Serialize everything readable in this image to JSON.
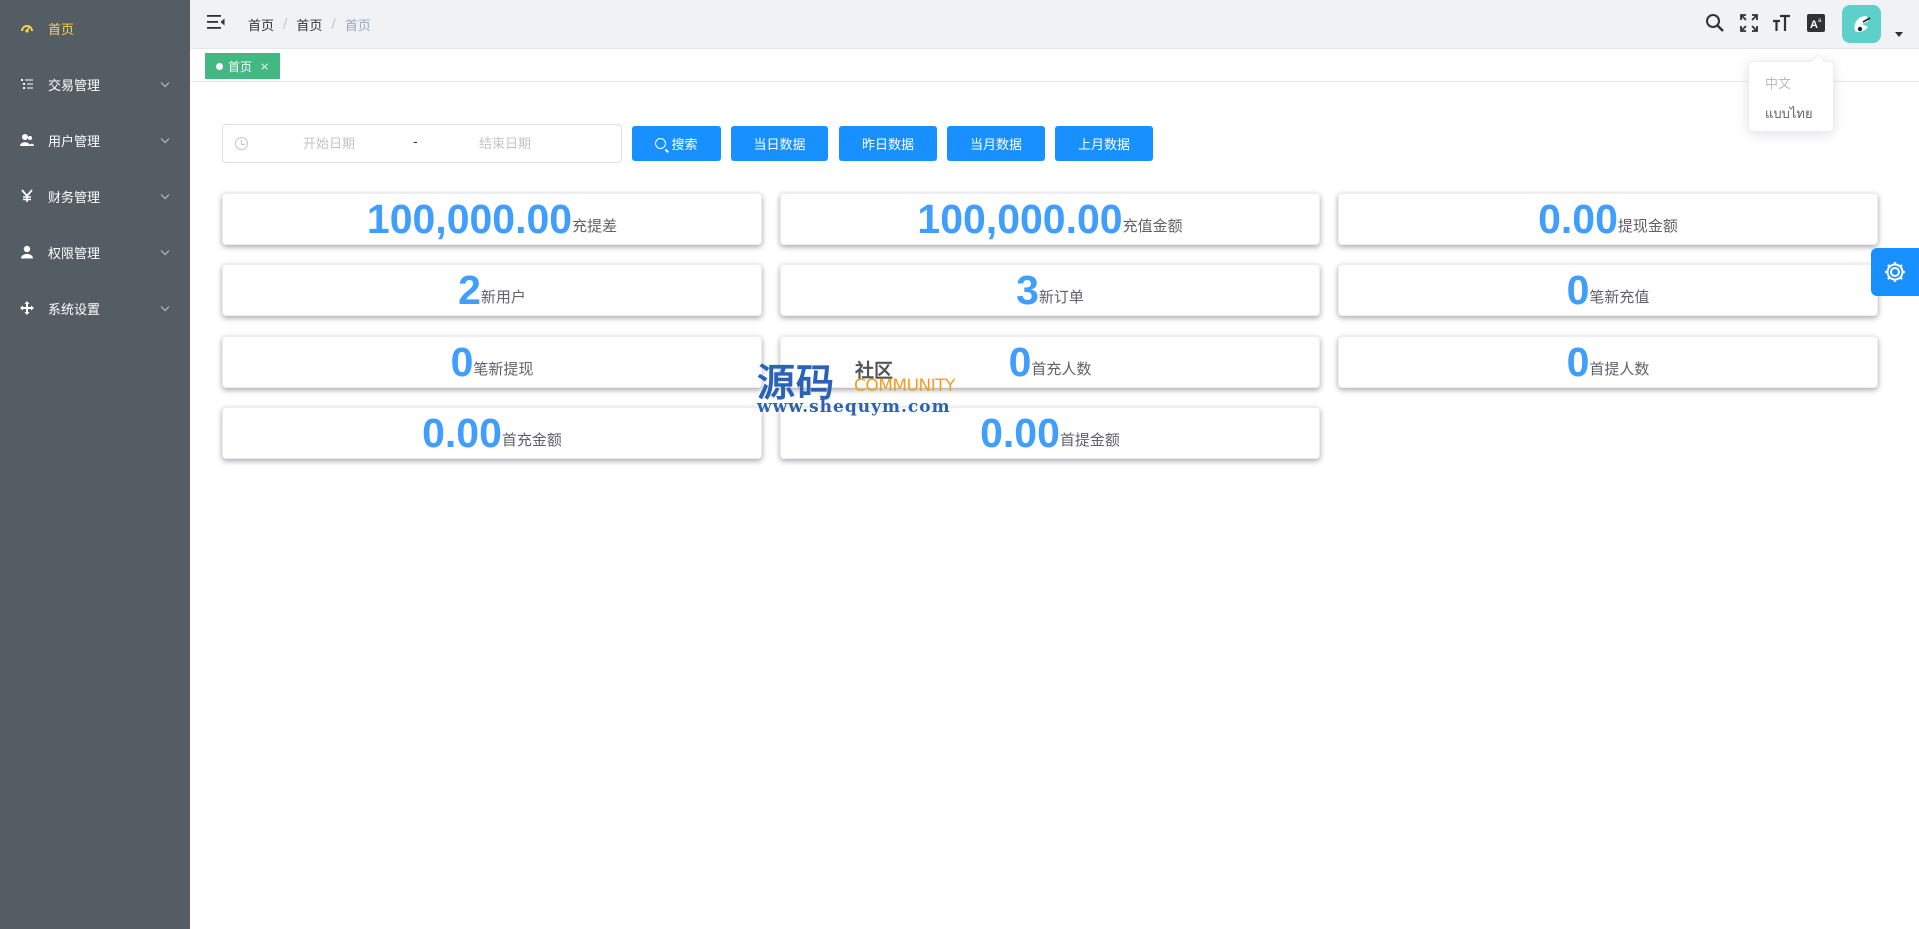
{
  "sidebar": {
    "items": [
      {
        "label": "首页",
        "icon": "dashboard-icon",
        "active": true
      },
      {
        "label": "交易管理",
        "icon": "list-icon"
      },
      {
        "label": "用户管理",
        "icon": "users-icon"
      },
      {
        "label": "财务管理",
        "icon": "yen-icon"
      },
      {
        "label": "权限管理",
        "icon": "user-icon"
      },
      {
        "label": "系统设置",
        "icon": "move-icon"
      }
    ]
  },
  "header": {
    "breadcrumb": [
      "首页",
      "首页",
      "首页"
    ],
    "icons": [
      "search-icon",
      "fullscreen-icon",
      "font-size-icon",
      "language-icon"
    ]
  },
  "tags": [
    {
      "label": "首页",
      "close": "×"
    }
  ],
  "language_menu": {
    "options": [
      "中文",
      "แบบไทย"
    ]
  },
  "filter": {
    "start_placeholder": "开始日期",
    "end_placeholder": "结束日期",
    "separator": "-",
    "search_label": "搜索",
    "buttons": [
      "当日数据",
      "昨日数据",
      "当月数据",
      "上月数据"
    ]
  },
  "stats": [
    {
      "value": "100,000.00",
      "label": "充提差"
    },
    {
      "value": "100,000.00",
      "label": "充值金额"
    },
    {
      "value": "0.00",
      "label": "提现金额"
    },
    {
      "value": "2",
      "label": "新用户"
    },
    {
      "value": "3",
      "label": "新订单"
    },
    {
      "value": "0",
      "label": "笔新充值"
    },
    {
      "value": "0",
      "label": "笔新提现"
    },
    {
      "value": "0",
      "label": "首充人数"
    },
    {
      "value": "0",
      "label": "首提人数"
    },
    {
      "value": "0.00",
      "label": "首充金额"
    },
    {
      "value": "0.00",
      "label": "首提金额"
    }
  ],
  "watermark": {
    "big": "源码",
    "small": "社区",
    "en": "COMMUNITY",
    "url": "www.shequym.com"
  },
  "colors": {
    "sidebar_bg": "#545c64",
    "active_menu": "#ffd04b",
    "primary": "#1890ff",
    "stat_number": "#409eff",
    "tag_green": "#42b983"
  }
}
